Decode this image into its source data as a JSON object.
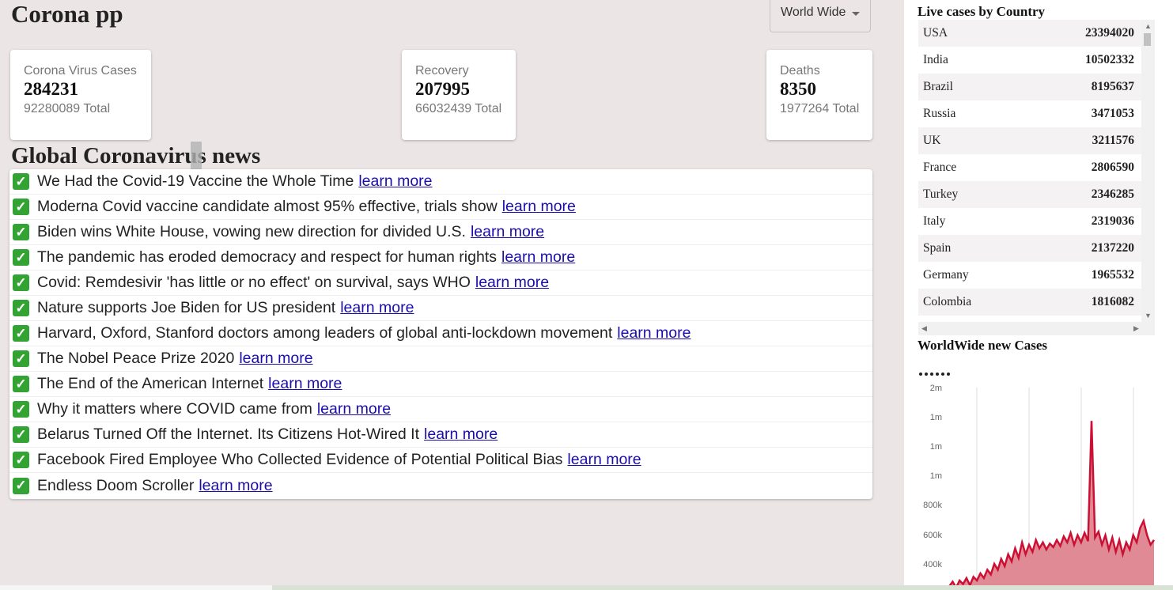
{
  "app": {
    "title": "Corona pp"
  },
  "country_select": {
    "value": "World Wide"
  },
  "stats": {
    "cases": {
      "title": "Corona Virus Cases",
      "value": "284231",
      "total": "92280089 Total"
    },
    "recovery": {
      "title": "Recovery",
      "value": "207995",
      "total": "66032439 Total"
    },
    "deaths": {
      "title": "Deaths",
      "value": "8350",
      "total": "1977264 Total"
    }
  },
  "news": {
    "heading": "Global Coronavirus news",
    "link_label": "learn more",
    "check_glyph": "✓",
    "items": [
      "We Had the Covid-19 Vaccine the Whole Time",
      "Moderna Covid vaccine candidate almost 95% effective, trials show",
      "Biden wins White House, vowing new direction for divided U.S.",
      "The pandemic has eroded democracy and respect for human rights",
      "Covid: Remdesivir 'has little or no effect' on survival, says WHO",
      "Nature supports Joe Biden for US president",
      "Harvard, Oxford, Stanford doctors among leaders of global anti-lockdown movement",
      "The Nobel Peace Prize 2020",
      "The End of the American Internet",
      "Why it matters where COVID came from",
      "Belarus Turned Off the Internet. Its Citizens Hot-Wired It",
      "Facebook Fired Employee Who Collected Evidence of Potential Political Bias",
      "Endless Doom Scroller"
    ]
  },
  "live_cases": {
    "title": "Live cases by Country",
    "rows": [
      {
        "country": "USA",
        "cases": "23394020"
      },
      {
        "country": "India",
        "cases": "10502332"
      },
      {
        "country": "Brazil",
        "cases": "8195637"
      },
      {
        "country": "Russia",
        "cases": "3471053"
      },
      {
        "country": "UK",
        "cases": "3211576"
      },
      {
        "country": "France",
        "cases": "2806590"
      },
      {
        "country": "Turkey",
        "cases": "2346285"
      },
      {
        "country": "Italy",
        "cases": "2319036"
      },
      {
        "country": "Spain",
        "cases": "2137220"
      },
      {
        "country": "Germany",
        "cases": "1965532"
      },
      {
        "country": "Colombia",
        "cases": "1816082"
      }
    ]
  },
  "new_cases": {
    "title": "WorldWide new Cases"
  },
  "chart_data": {
    "type": "area",
    "title": "",
    "ytick_labels": [
      "2m",
      "1m",
      "1m",
      "1m",
      "800k",
      "600k",
      "400k"
    ],
    "ylim": [
      300000,
      2000000
    ],
    "grid_x": true,
    "colors": {
      "line": "#cc1034",
      "fill": "#e08a96"
    },
    "values": [
      330000,
      370000,
      320000,
      380000,
      350000,
      400000,
      340000,
      410000,
      380000,
      440000,
      400000,
      470000,
      430000,
      520000,
      470000,
      560000,
      500000,
      600000,
      540000,
      650000,
      570000,
      700000,
      600000,
      680000,
      620000,
      720000,
      650000,
      700000,
      640000,
      690000,
      660000,
      720000,
      670000,
      750000,
      700000,
      780000,
      680000,
      760000,
      700000,
      780000,
      710000,
      1720000,
      740000,
      790000,
      680000,
      760000,
      640000,
      740000,
      620000,
      720000,
      600000,
      700000,
      640000,
      760000,
      700000,
      820000,
      880000,
      760000,
      680000,
      720000
    ]
  }
}
